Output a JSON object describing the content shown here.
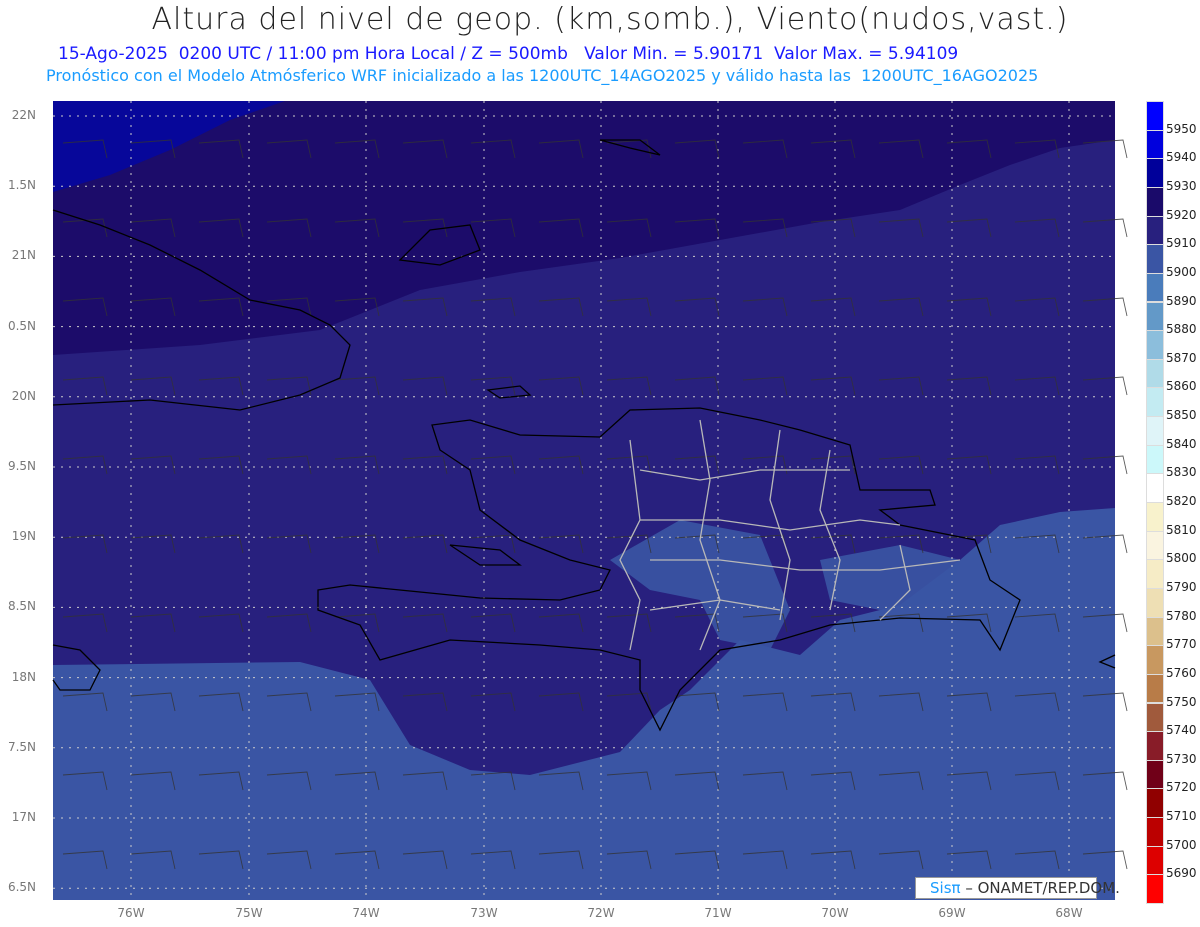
{
  "title": "Altura del nivel de geop. (km,somb.), Viento(nudos,vast.)",
  "subtitle1": "15-Ago-2025  0200 UTC / 11:00 pm Hora Local / Z = 500mb   Valor Min. = 5.90171  Valor Max. = 5.94109",
  "subtitle2": "Pronóstico con el Modelo Atmósferico WRF inicializado a las 1200UTC_14AGO2025 y válido hasta las  1200UTC_16AGO2025",
  "y_labels": [
    "22N",
    "1.5N",
    "21N",
    "0.5N",
    "20N",
    "9.5N",
    "19N",
    "8.5N",
    "18N",
    "7.5N",
    "17N",
    "6.5N"
  ],
  "x_labels": [
    "76W",
    "75W",
    "74W",
    "73W",
    "72W",
    "71W",
    "70W",
    "69W",
    "68W"
  ],
  "colorbar": {
    "labels": [
      "5950",
      "5940",
      "5930",
      "5920",
      "5910",
      "5900",
      "5890",
      "5880",
      "5870",
      "5860",
      "5850",
      "5840",
      "5830",
      "5820",
      "5810",
      "5800",
      "5790",
      "5780",
      "5770",
      "5760",
      "5750",
      "5740",
      "5730",
      "5720",
      "5710",
      "5700",
      "5690"
    ],
    "colors": [
      "#0000ff",
      "#0000dd",
      "#00009a",
      "#1a0a6a",
      "#28207e",
      "#3a55a4",
      "#4a7cbb",
      "#6399c8",
      "#8cbedc",
      "#b0dbe8",
      "#c3ebf2",
      "#dff4f8",
      "#ccf8fa",
      "#ffffff",
      "#f8f2cc",
      "#faf4e0",
      "#f6ecc6",
      "#eedfb4",
      "#dcc08c",
      "#c89860",
      "#b87c48",
      "#a05a3c",
      "#881c28",
      "#700018",
      "#900000",
      "#bb0000",
      "#dd0000",
      "#ff0000"
    ]
  },
  "logo": {
    "brand": "Sisπ",
    "text": " – ONAMET/REP.DOM."
  }
}
